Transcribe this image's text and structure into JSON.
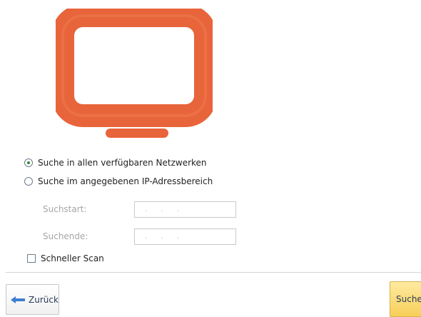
{
  "illustration": {
    "icon": "monitor-icon",
    "color": "#e8643a"
  },
  "scan_mode": {
    "options": [
      {
        "label": "Suche in allen verfügbaren Netzwerken",
        "selected": true
      },
      {
        "label": "Suche im angegebenen IP-Adressbereich",
        "selected": false
      }
    ]
  },
  "range": {
    "start_label": "Suchstart:",
    "start_value": ". . .",
    "end_label": "Suchende:",
    "end_value": ". . ."
  },
  "fast_scan": {
    "label": "Schneller Scan",
    "checked": false
  },
  "footer": {
    "back_label": "Zurück",
    "search_label": "Suche"
  },
  "colors": {
    "accent": "#e8643a",
    "primary_button": "#f7cf5a",
    "radio_dot": "#2e8b3d"
  }
}
